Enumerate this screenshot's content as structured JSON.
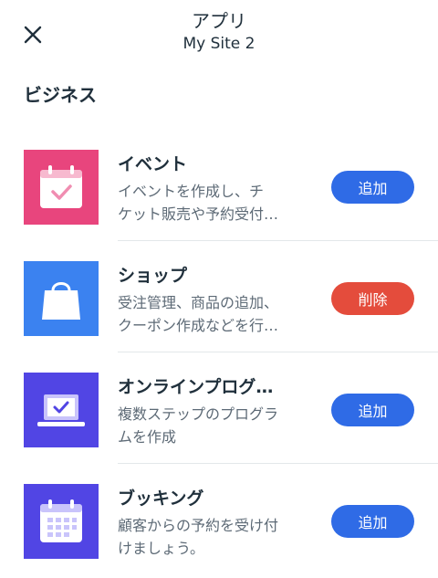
{
  "header": {
    "title": "アプリ",
    "subtitle": "My Site 2",
    "close_icon": "close-icon"
  },
  "section": {
    "title": "ビジネス"
  },
  "apps": [
    {
      "name": "イベント",
      "desc_line1": "イベントを作成し、チ",
      "desc_line2": "ケット販売や予約受付…",
      "action": "追加",
      "icon": "calendar-check-icon",
      "icon_bg": "#e8457d",
      "button_color": "#2f6be6"
    },
    {
      "name": "ショップ",
      "desc_line1": "受注管理、商品の追加、",
      "desc_line2": "クーポン作成などを行…",
      "action": "削除",
      "icon": "shopping-bag-icon",
      "icon_bg": "#3b82f0",
      "button_color": "#e44c3c"
    },
    {
      "name": "オンラインプログ…",
      "desc_line1": "複数ステップのプログラ",
      "desc_line2": "ムを作成",
      "action": "追加",
      "icon": "laptop-check-icon",
      "icon_bg": "#5145e4",
      "button_color": "#2f6be6"
    },
    {
      "name": "ブッキング",
      "desc_line1": "顧客からの予約を受け付",
      "desc_line2": "けましょう。",
      "action": "追加",
      "icon": "calendar-grid-icon",
      "icon_bg": "#5145e4",
      "button_color": "#2f6be6"
    }
  ]
}
